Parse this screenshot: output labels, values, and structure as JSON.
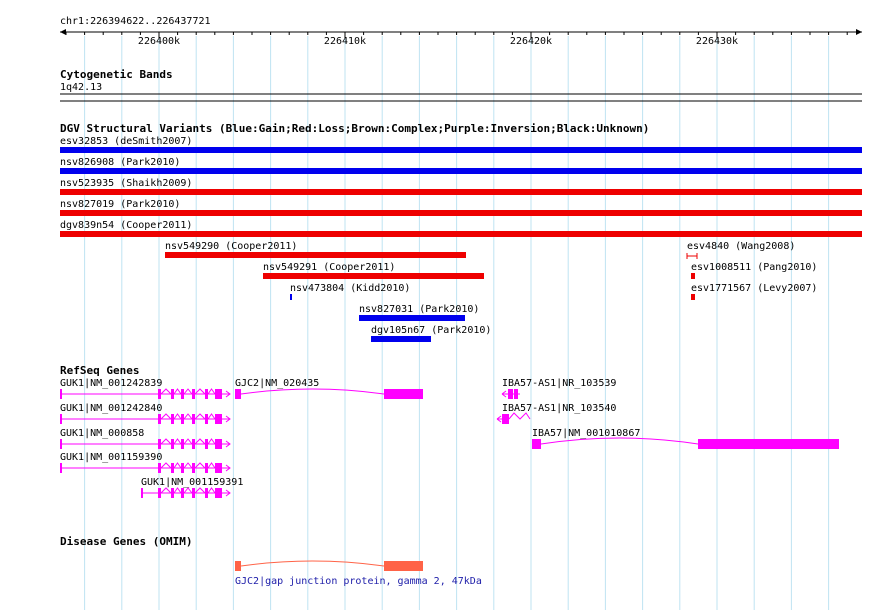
{
  "location": "chr1:226394622..226437721",
  "ruler": {
    "ticks": [
      {
        "label": "226400k",
        "value": 226400000
      },
      {
        "label": "226410k",
        "value": 226410000
      },
      {
        "label": "226420k",
        "value": 226420000
      },
      {
        "label": "226430k",
        "value": 226430000
      }
    ]
  },
  "tracks": {
    "cytoband": {
      "title": "Cytogenetic Bands",
      "band": "1q42.13"
    },
    "dgv": {
      "title": "DGV Structural Variants (Blue:Gain;Red:Loss;Brown:Complex;Purple:Inversion;Black:Unknown)",
      "colors": {
        "gain": "#0000ee",
        "loss": "#ee0000"
      },
      "variants": [
        {
          "label": "esv32853 (deSmith2007)",
          "type": "gain",
          "full": true
        },
        {
          "label": "nsv826908 (Park2010)",
          "type": "gain",
          "full": true
        },
        {
          "label": "nsv523935 (Shaikh2009)",
          "type": "loss",
          "full": true
        },
        {
          "label": "nsv827019 (Park2010)",
          "type": "loss",
          "full": true
        },
        {
          "label": "dgv839n54 (Cooper2011)",
          "type": "loss",
          "full": true
        },
        {
          "label": "nsv549290 (Cooper2011)",
          "type": "loss"
        },
        {
          "label": "nsv549291 (Cooper2011)",
          "type": "loss"
        },
        {
          "label": "nsv473804 (Kidd2010)",
          "type": "gain"
        },
        {
          "label": "nsv827031 (Park2010)",
          "type": "gain"
        },
        {
          "label": "dgv105n67 (Park2010)",
          "type": "gain"
        },
        {
          "label": "esv4840 (Wang2008)",
          "type": "loss"
        },
        {
          "label": "esv1008511 (Pang2010)",
          "type": "loss"
        },
        {
          "label": "esv1771567 (Levy2007)",
          "type": "loss"
        }
      ]
    },
    "refseq": {
      "title": "RefSeq Genes",
      "color": "#ff00ff",
      "genes": [
        {
          "label": "GUK1|NM_001242839"
        },
        {
          "label": "GJC2|NM_020435"
        },
        {
          "label": "IBA57-AS1|NR_103539"
        },
        {
          "label": "GUK1|NM_001242840"
        },
        {
          "label": "IBA57-AS1|NR_103540"
        },
        {
          "label": "GUK1|NM_000858"
        },
        {
          "label": "IBA57|NM_001010867"
        },
        {
          "label": "GUK1|NM_001159390"
        },
        {
          "label": "GUK1|NM_001159391"
        }
      ]
    },
    "omim": {
      "title": "Disease Genes (OMIM)",
      "color": "#ff6347",
      "label": "GJC2|gap junction protein, gamma 2, 47kDa"
    }
  }
}
